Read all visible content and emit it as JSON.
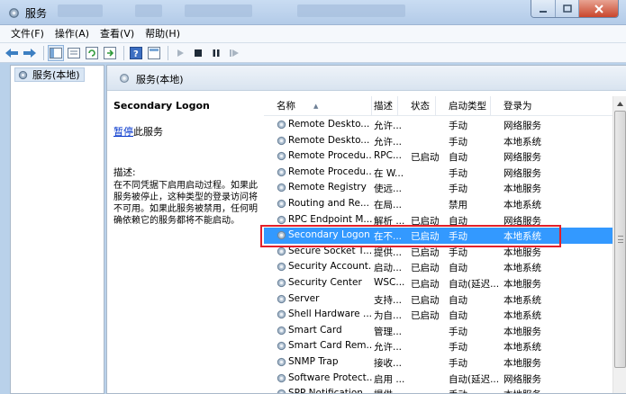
{
  "window": {
    "title": "服务"
  },
  "menu": [
    "文件(F)",
    "操作(A)",
    "查看(V)",
    "帮助(H)"
  ],
  "tree": {
    "root_label": "服务(本地)"
  },
  "panel": {
    "header": "服务(本地)"
  },
  "detail": {
    "service_name": "Secondary Logon",
    "action_link": "暂停",
    "action_suffix": "此服务",
    "description_label": "描述:",
    "description": "在不同凭据下启用启动过程。如果此服务被停止，这种类型的登录访问将不可用。如果此服务被禁用，任何明确依赖它的服务都将不能启动。"
  },
  "columns": [
    "名称",
    "描述",
    "状态",
    "启动类型",
    "登录为"
  ],
  "rows": [
    {
      "name": "Remote Deskto...",
      "desc": "允许...",
      "status": "",
      "startup": "手动",
      "logon": "网络服务"
    },
    {
      "name": "Remote Deskto...",
      "desc": "允许...",
      "status": "",
      "startup": "手动",
      "logon": "本地系统"
    },
    {
      "name": "Remote Procedu...",
      "desc": "RPC...",
      "status": "已启动",
      "startup": "自动",
      "logon": "网络服务"
    },
    {
      "name": "Remote Procedu...",
      "desc": "在 W...",
      "status": "",
      "startup": "手动",
      "logon": "网络服务"
    },
    {
      "name": "Remote Registry",
      "desc": "使远...",
      "status": "",
      "startup": "手动",
      "logon": "本地服务"
    },
    {
      "name": "Routing and Re...",
      "desc": "在局...",
      "status": "",
      "startup": "禁用",
      "logon": "本地系统"
    },
    {
      "name": "RPC Endpoint M...",
      "desc": "解析 ...",
      "status": "已启动",
      "startup": "自动",
      "logon": "网络服务"
    },
    {
      "name": "Secondary Logon",
      "desc": "在不...",
      "status": "已启动",
      "startup": "手动",
      "logon": "本地系统",
      "selected": true
    },
    {
      "name": "Secure Socket T...",
      "desc": "提供...",
      "status": "已启动",
      "startup": "手动",
      "logon": "本地服务"
    },
    {
      "name": "Security Account...",
      "desc": "启动...",
      "status": "已启动",
      "startup": "自动",
      "logon": "本地系统"
    },
    {
      "name": "Security Center",
      "desc": "WSC...",
      "status": "已启动",
      "startup": "自动(延迟...",
      "logon": "本地服务"
    },
    {
      "name": "Server",
      "desc": "支持...",
      "status": "已启动",
      "startup": "自动",
      "logon": "本地系统"
    },
    {
      "name": "Shell Hardware ...",
      "desc": "为自...",
      "status": "已启动",
      "startup": "自动",
      "logon": "本地系统"
    },
    {
      "name": "Smart Card",
      "desc": "管理...",
      "status": "",
      "startup": "手动",
      "logon": "本地服务"
    },
    {
      "name": "Smart Card Rem...",
      "desc": "允许...",
      "status": "",
      "startup": "手动",
      "logon": "本地系统"
    },
    {
      "name": "SNMP Trap",
      "desc": "接收...",
      "status": "",
      "startup": "手动",
      "logon": "本地服务"
    },
    {
      "name": "Software Protect...",
      "desc": "启用 ...",
      "status": "",
      "startup": "自动(延迟...",
      "logon": "网络服务"
    },
    {
      "name": "SPP Notification ...",
      "desc": "提供 ...",
      "status": "",
      "startup": "手动",
      "logon": "本地服务"
    }
  ],
  "colors": {
    "selection": "#3399ff",
    "highlight_box": "#e3202a",
    "link": "#0033cc"
  }
}
